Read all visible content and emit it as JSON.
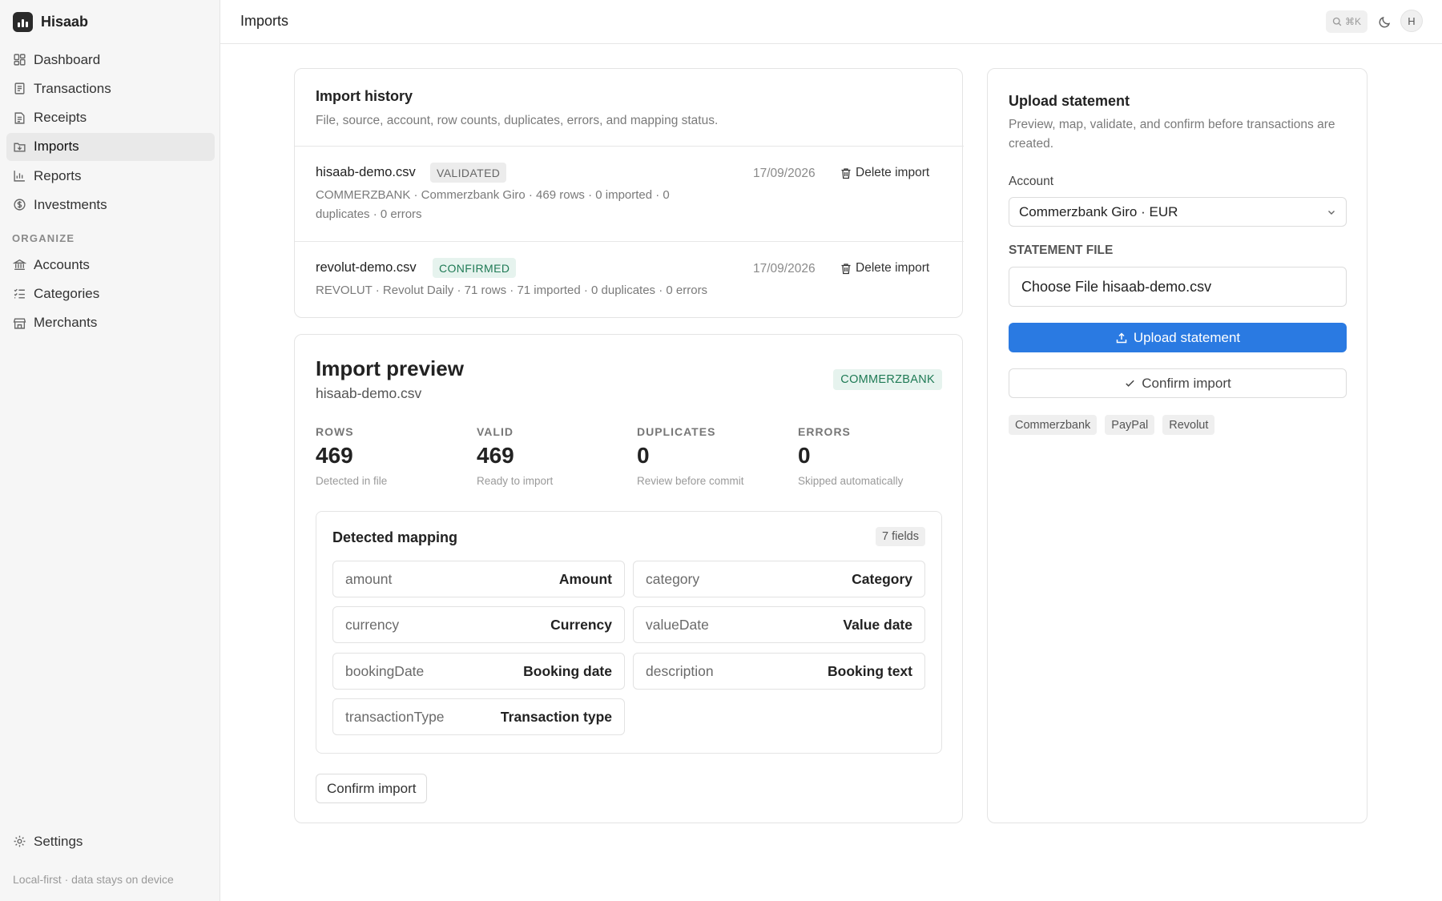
{
  "app": {
    "name": "Hisaab"
  },
  "sidebar": {
    "items": [
      {
        "label": "Dashboard",
        "icon": "dashboard-icon"
      },
      {
        "label": "Transactions",
        "icon": "transactions-icon"
      },
      {
        "label": "Receipts",
        "icon": "receipt-icon"
      },
      {
        "label": "Imports",
        "icon": "import-icon",
        "active": true
      },
      {
        "label": "Reports",
        "icon": "bar-chart-icon"
      },
      {
        "label": "Investments",
        "icon": "coin-icon"
      }
    ],
    "section_label": "ORGANIZE",
    "organize_items": [
      {
        "label": "Accounts",
        "icon": "bank-icon"
      },
      {
        "label": "Categories",
        "icon": "list-icon"
      },
      {
        "label": "Merchants",
        "icon": "store-icon"
      }
    ],
    "settings_label": "Settings",
    "footnote": "Local-first · data stays on device"
  },
  "topbar": {
    "title": "Imports",
    "search_shortcut": "⌘K",
    "avatar_initial": "H"
  },
  "history": {
    "title": "Import history",
    "subtitle": "File, source, account, row counts, duplicates, errors, and mapping status.",
    "rows": [
      {
        "file": "hisaab-demo.csv",
        "status": "VALIDATED",
        "meta": "COMMERZBANK · Commerzbank Giro · 469 rows · 0 imported · 0 duplicates · 0 errors",
        "date": "17/09/2026",
        "action": "Delete import"
      },
      {
        "file": "revolut-demo.csv",
        "status": "CONFIRMED",
        "meta": "REVOLUT · Revolut Daily · 71 rows · 71 imported · 0 duplicates · 0 errors",
        "date": "17/09/2026",
        "action": "Delete import"
      }
    ]
  },
  "preview": {
    "title": "Import preview",
    "file": "hisaab-demo.csv",
    "bank": "COMMERZBANK",
    "stats": [
      {
        "label": "ROWS",
        "value": "469",
        "caption": "Detected in file"
      },
      {
        "label": "VALID",
        "value": "469",
        "caption": "Ready to import"
      },
      {
        "label": "DUPLICATES",
        "value": "0",
        "caption": "Review before commit"
      },
      {
        "label": "ERRORS",
        "value": "0",
        "caption": "Skipped automatically"
      }
    ],
    "mapping": {
      "title": "Detected mapping",
      "count": "7 fields",
      "fields": [
        {
          "key": "amount",
          "value": "Amount"
        },
        {
          "key": "category",
          "value": "Category"
        },
        {
          "key": "currency",
          "value": "Currency"
        },
        {
          "key": "valueDate",
          "value": "Value date"
        },
        {
          "key": "bookingDate",
          "value": "Booking date"
        },
        {
          "key": "description",
          "value": "Booking text"
        },
        {
          "key": "transactionType",
          "value": "Transaction type"
        }
      ]
    },
    "confirm_label": "Confirm import"
  },
  "upload": {
    "title": "Upload statement",
    "description": "Preview, map, validate, and confirm before transactions are created.",
    "account_label": "Account",
    "account_value": "Commerzbank Giro · EUR",
    "file_label": "STATEMENT FILE",
    "file_value": "Choose File hisaab-demo.csv",
    "upload_label": "Upload statement",
    "confirm_label": "Confirm import",
    "tags": [
      "Commerzbank",
      "PayPal",
      "Revolut"
    ]
  },
  "colors": {
    "accent": "#2a7ae2",
    "success_bg": "#e6f3ee",
    "success_text": "#1f7a55"
  }
}
